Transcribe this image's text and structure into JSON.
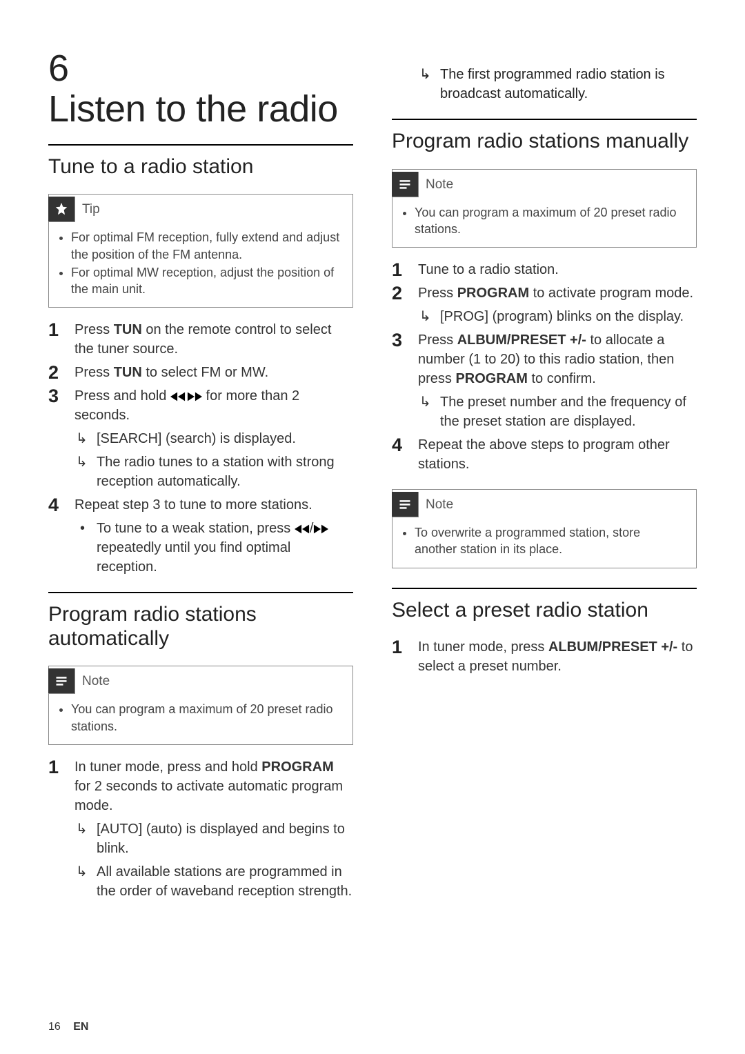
{
  "chapter": {
    "num": "6",
    "title": "Listen to the radio"
  },
  "footer": {
    "page": "16",
    "lang": "EN"
  },
  "left": {
    "s1": {
      "heading": "Tune to a radio station",
      "tip_label": "Tip",
      "tips": [
        "For optimal FM reception, fully extend and adjust the position of the FM antenna.",
        "For optimal MW reception, adjust the position of the main unit."
      ],
      "step1a": "Press ",
      "step1b": "TUN",
      "step1c": " on the remote control to select the tuner source.",
      "step2a": "Press ",
      "step2b": "TUN",
      "step2c": " to select FM or MW.",
      "step3a": "Press and hold ",
      "step3b": " for more than 2 seconds.",
      "step3_r1": "[SEARCH] (search) is displayed.",
      "step3_r2": "The radio tunes to a station with strong reception automatically.",
      "step4": "Repeat step 3 to tune to more stations.",
      "step4_b1a": "To tune to a weak station, press ",
      "step4_b1b": " repeatedly until you find optimal reception."
    },
    "s2": {
      "heading": "Program radio stations automatically",
      "note_label": "Note",
      "note": "You can program a maximum of 20 preset radio stations.",
      "step1a": "In tuner mode, press and hold ",
      "step1b": "PROGRAM",
      "step1c": " for 2 seconds to activate automatic program mode.",
      "step1_r1": "[AUTO] (auto) is displayed and begins to blink.",
      "step1_r2": "All available stations are programmed in the order of waveband reception strength."
    }
  },
  "right": {
    "cont_r1": "The first programmed radio station is broadcast automatically.",
    "s3": {
      "heading": "Program radio stations manually",
      "note_label": "Note",
      "note1": "You can program a maximum of 20 preset radio stations.",
      "step1": "Tune to a radio station.",
      "step2a": "Press ",
      "step2b": "PROGRAM",
      "step2c": " to activate program mode.",
      "step2_r1": "[PROG] (program) blinks on the display.",
      "step3a": "Press ",
      "step3b": "ALBUM/PRESET +/-",
      "step3c": " to allocate a number (1 to 20) to this radio station, then press ",
      "step3d": "PROGRAM",
      "step3e": " to confirm.",
      "step3_r1": "The preset number and the frequency of the preset station are displayed.",
      "step4": "Repeat the above steps to program other stations.",
      "note2_label": "Note",
      "note2": "To overwrite a programmed station, store another station in its place."
    },
    "s4": {
      "heading": "Select a preset radio station",
      "step1a": "In tuner mode, press ",
      "step1b": "ALBUM/PRESET +/-",
      "step1c": " to select a preset number."
    }
  }
}
